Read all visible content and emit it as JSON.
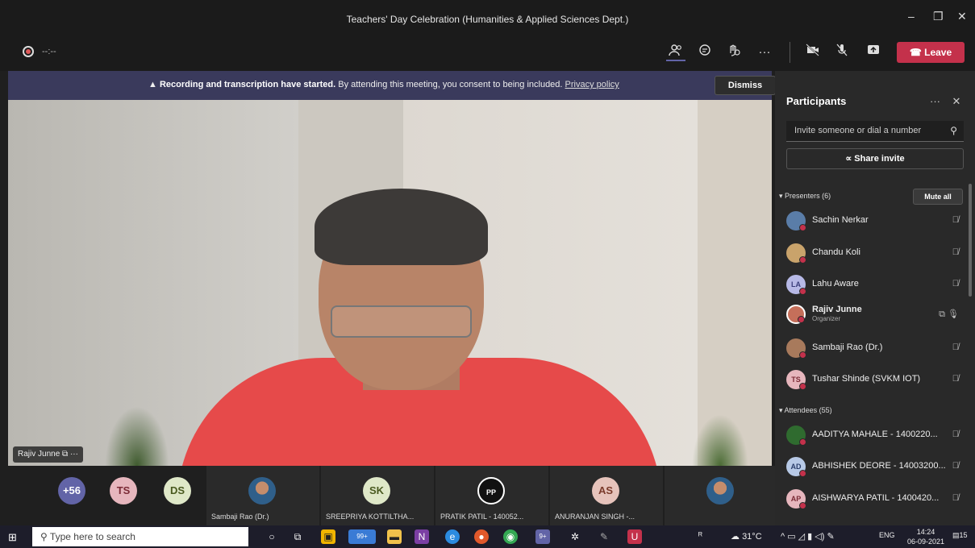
{
  "window": {
    "title": "Teachers' Day Celebration (Humanities & Applied Sciences Dept.)",
    "minimize": "–",
    "restore": "❐",
    "close": "✕"
  },
  "toolbar": {
    "timer": "--:--",
    "leave_label": "Leave"
  },
  "banner": {
    "bold_text": "Recording and transcription have started.",
    "text": "By attending this meeting, you consent to being included.",
    "link": "Privacy policy",
    "dismiss_label": "Dismiss"
  },
  "stage": {
    "speaker_name": "Rajiv Junne",
    "more": "···"
  },
  "gallery": {
    "overflow": "+56",
    "tiles": [
      {
        "initials": "TS",
        "color": "#e6b6bd",
        "text_color": "#7a2a35"
      },
      {
        "initials": "DS",
        "color": "#dfe8c8",
        "text_color": "#4a5a20"
      },
      {
        "initials": "SK",
        "color": "#dfe8c8",
        "text_color": "#4a5a20"
      },
      {
        "initials": "PP",
        "color": "#111111",
        "text_color": "#ffffff"
      },
      {
        "initials": "AS",
        "color": "#e6c3bb",
        "text_color": "#7a3a2a"
      }
    ],
    "labels": [
      "Sambaji Rao (Dr.)",
      "SREEPRIYA KOTTILTHA...",
      "PRATIK PATIL - 140052...",
      "ANURANJAN SINGH -..."
    ]
  },
  "panel": {
    "title": "Participants",
    "more": "···",
    "close": "✕",
    "invite_placeholder": "Invite someone or dial a number",
    "share_label": "Share invite",
    "presenters_header": "Presenters (6)",
    "mute_all": "Mute all",
    "attendees_header": "Attendees (55)",
    "presenters": [
      {
        "name": "Sachin Nerkar",
        "initials": "",
        "color": "#5a7da8",
        "photo": true
      },
      {
        "name": "Chandu Koli",
        "initials": "",
        "color": "#c9a36b",
        "photo": true
      },
      {
        "name": "Lahu Aware",
        "initials": "LA",
        "color": "#b7b9e6",
        "photo": false
      },
      {
        "name": "Rajiv Junne",
        "initials": "",
        "color": "#c56f5a",
        "photo": true,
        "role": "Organizer"
      },
      {
        "name": "Sambaji Rao (Dr.)",
        "initials": "",
        "color": "#a87a5c",
        "photo": true
      },
      {
        "name": "Tushar Shinde (SVKM IOT)",
        "initials": "TS",
        "color": "#e6b6bd",
        "photo": false
      }
    ],
    "attendees": [
      {
        "name": "AADITYA MAHALE - 1400220...",
        "initials": "",
        "color": "#2f6b2f",
        "photo": true
      },
      {
        "name": "ABHISHEK DEORE - 14003200...",
        "initials": "AD",
        "color": "#b7c9e6",
        "photo": false
      },
      {
        "name": "AISHWARYA PATIL - 1400420...",
        "initials": "AP",
        "color": "#e6b6bd",
        "photo": false
      }
    ]
  },
  "taskbar": {
    "search_placeholder": "Type here to search",
    "weather": "31°C",
    "lang": "ENG",
    "time": "14:24",
    "date": "06-09-2021",
    "edge_badge": "99+",
    "teams_badge": "9+",
    "notif_count": "15"
  }
}
